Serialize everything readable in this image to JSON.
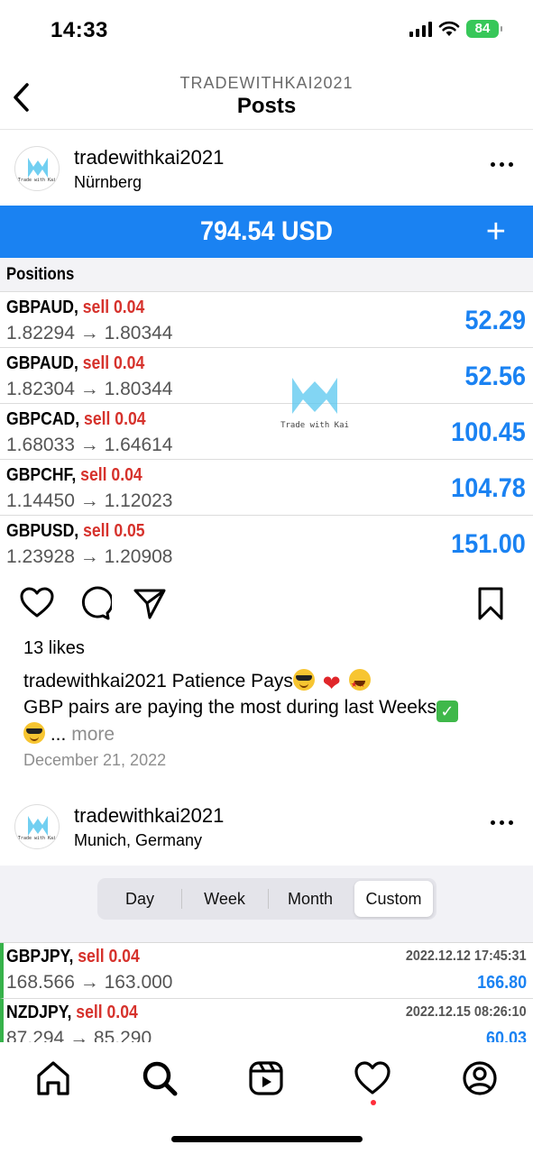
{
  "status_bar": {
    "time": "14:33",
    "battery": "84"
  },
  "header": {
    "account": "TRADEWITHKAI2021",
    "title": "Posts"
  },
  "posts": [
    {
      "username": "tradewithkai2021",
      "location": "Nürnberg",
      "avatar_text": "Trade with Kai",
      "image": {
        "balance": "794.54 USD",
        "plus": "+",
        "positions_title": "Positions",
        "watermark": "Trade with Kai",
        "positions": [
          {
            "symbol": "GBPAUD,",
            "side": "sell 0.04",
            "prices": "1.82294 → 1.80344",
            "profit": "52.29"
          },
          {
            "symbol": "GBPAUD,",
            "side": "sell 0.04",
            "prices": "1.82304 → 1.80344",
            "profit": "52.56"
          },
          {
            "symbol": "GBPCAD,",
            "side": "sell 0.04",
            "prices": "1.68033 → 1.64614",
            "profit": "100.45"
          },
          {
            "symbol": "GBPCHF,",
            "side": "sell 0.04",
            "prices": "1.14450 → 1.12023",
            "profit": "104.78"
          },
          {
            "symbol": "GBPUSD,",
            "side": "sell 0.05",
            "prices": "1.23928 → 1.20908",
            "profit": "151.00"
          }
        ]
      },
      "likes": "13 likes",
      "caption_user": "tradewithkai2021",
      "caption_line1": "Patience Pays",
      "caption_line2": "GBP pairs are paying the most during last Weeks",
      "ellipsis": "...",
      "more": "more",
      "date": "December 21, 2022"
    },
    {
      "username": "tradewithkai2021",
      "location": "Munich, Germany",
      "avatar_text": "Trade with Kai",
      "image": {
        "tabs": [
          "Day",
          "Week",
          "Month",
          "Custom"
        ],
        "active_tab": "Custom",
        "history": [
          {
            "symbol": "GBPJPY,",
            "side": "sell 0.04",
            "datetime": "2022.12.12 17:45:31",
            "prices": "168.566 → 163.000",
            "profit": "166.80"
          },
          {
            "symbol": "NZDJPY,",
            "side": "sell 0.04",
            "datetime": "2022.12.15 08:26:10",
            "prices": "87.294 → 85.290",
            "profit": "60.03"
          }
        ]
      }
    }
  ],
  "colors": {
    "accent_blue": "#1a82f2",
    "sell_red": "#d6322c",
    "battery_green": "#37c759",
    "profit_bar_green": "#36b24a"
  },
  "icons": [
    "back-chevron-icon",
    "more-icon",
    "heart-icon",
    "comment-icon",
    "share-icon",
    "bookmark-icon",
    "home-icon",
    "search-icon",
    "reels-icon",
    "activity-heart-icon",
    "profile-icon"
  ]
}
